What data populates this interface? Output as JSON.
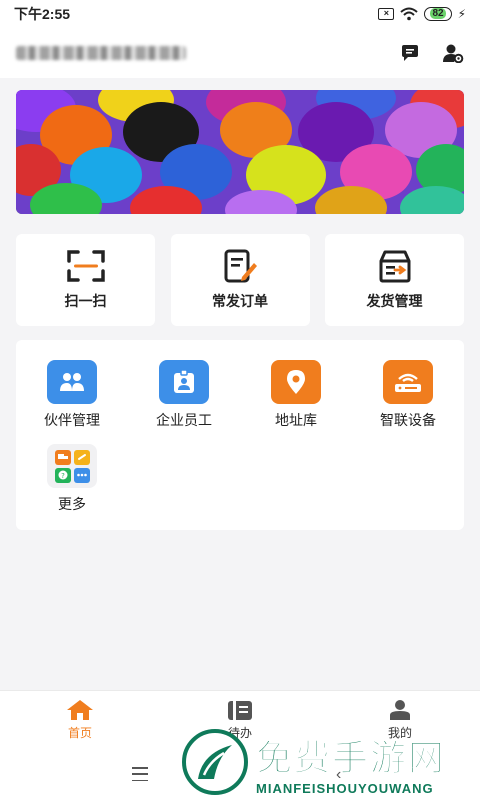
{
  "status": {
    "time": "下午2:55",
    "battery": "82"
  },
  "header": {
    "title_blurred": true
  },
  "banner": {
    "alt": "balloons"
  },
  "quick": [
    {
      "label": "扫一扫",
      "icon": "scan-icon"
    },
    {
      "label": "常发订单",
      "icon": "order-edit-icon"
    },
    {
      "label": "发货管理",
      "icon": "shipping-box-icon"
    }
  ],
  "grid": [
    {
      "label": "伙伴管理",
      "icon": "partners-icon",
      "color": "#3d8fe8"
    },
    {
      "label": "企业员工",
      "icon": "employee-badge-icon",
      "color": "#3d8fe8"
    },
    {
      "label": "地址库",
      "icon": "location-pin-icon",
      "color": "#f07d1e"
    },
    {
      "label": "智联设备",
      "icon": "router-device-icon",
      "color": "#f07d1e"
    },
    {
      "label": "更多",
      "icon": "more-apps-icon",
      "color": "#f1f1f3"
    }
  ],
  "tabs": [
    {
      "label": "首页",
      "icon": "home-icon",
      "active": true
    },
    {
      "label": "待办",
      "icon": "todo-list-icon",
      "active": false
    },
    {
      "label": "我的",
      "icon": "profile-icon",
      "active": false
    }
  ],
  "watermark": {
    "cn": "免费手游网",
    "en": "MIANFEISHOUYOUWANG"
  },
  "colors": {
    "accent": "#f07d1e",
    "blue": "#3d8fe8",
    "watermark": "#0f7a5a"
  }
}
